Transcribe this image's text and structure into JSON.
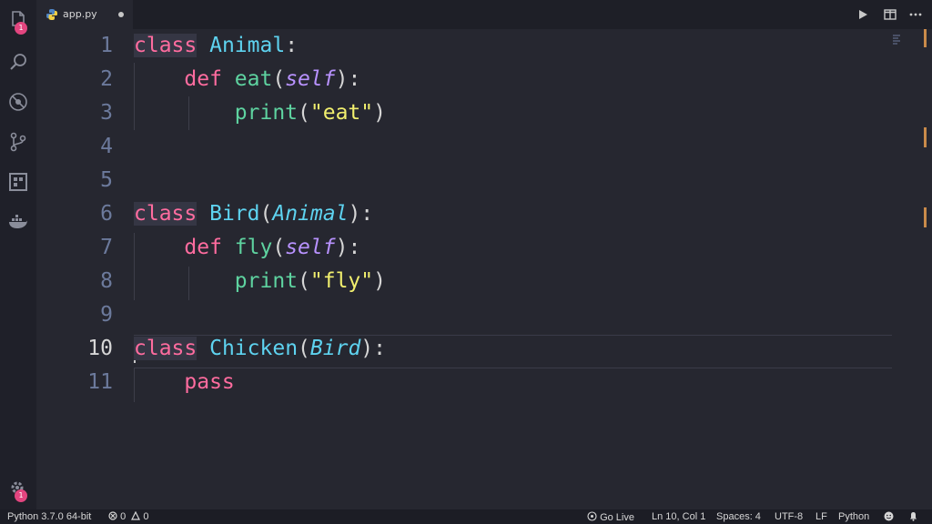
{
  "window": {
    "tab_title": "app.py"
  },
  "activity_bar": {
    "explorer_badge": "1",
    "settings_badge": "1"
  },
  "editor": {
    "line_numbers": [
      "1",
      "2",
      "3",
      "4",
      "5",
      "6",
      "7",
      "8",
      "9",
      "10",
      "11"
    ],
    "active_line": "10",
    "lines": [
      [
        [
          "k",
          "class"
        ],
        [
          "p",
          " "
        ],
        [
          "c",
          "Animal"
        ],
        [
          "p",
          ":"
        ]
      ],
      [
        [
          "p",
          "    "
        ],
        [
          "k",
          "def"
        ],
        [
          "p",
          " "
        ],
        [
          "f",
          "eat"
        ],
        [
          "p",
          "("
        ],
        [
          "self",
          "self"
        ],
        [
          "p",
          "):"
        ]
      ],
      [
        [
          "p",
          "        "
        ],
        [
          "f",
          "print"
        ],
        [
          "p",
          "("
        ],
        [
          "s",
          "\"eat\""
        ],
        [
          "p",
          ")"
        ]
      ],
      [],
      [],
      [
        [
          "k",
          "class"
        ],
        [
          "p",
          " "
        ],
        [
          "c",
          "Bird"
        ],
        [
          "p",
          "("
        ],
        [
          "inh",
          "Animal"
        ],
        [
          "p",
          "):"
        ]
      ],
      [
        [
          "p",
          "    "
        ],
        [
          "k",
          "def"
        ],
        [
          "p",
          " "
        ],
        [
          "f",
          "fly"
        ],
        [
          "p",
          "("
        ],
        [
          "self",
          "self"
        ],
        [
          "p",
          "):"
        ]
      ],
      [
        [
          "p",
          "        "
        ],
        [
          "f",
          "print"
        ],
        [
          "p",
          "("
        ],
        [
          "s",
          "\"fly\""
        ],
        [
          "p",
          ")"
        ]
      ],
      [],
      [
        [
          "k",
          "class"
        ],
        [
          "p",
          " "
        ],
        [
          "c",
          "Chicken"
        ],
        [
          "p",
          "("
        ],
        [
          "inh",
          "Bird"
        ],
        [
          "p",
          "):"
        ]
      ],
      [
        [
          "p",
          "    "
        ],
        [
          "k",
          "pass"
        ]
      ]
    ]
  },
  "status_bar": {
    "interpreter": "Python 3.7.0 64-bit",
    "errors": "0",
    "warnings": "0",
    "go_live": "Go Live",
    "cursor_position": "Ln 10, Col 1",
    "spaces": "Spaces: 4",
    "encoding": "UTF-8",
    "eol": "LF",
    "language": "Python"
  },
  "colors": {
    "keyword": "#ff6c9f",
    "class_name": "#5ed3f0",
    "function": "#5ed3a0",
    "string": "#f1ef6e",
    "self": "#b892ff",
    "background": "#262730"
  },
  "icons": [
    "files-icon",
    "search-icon",
    "debug-icon",
    "source-control-icon",
    "extensions-icon",
    "docker-icon",
    "settings-gear-icon",
    "python-file-icon",
    "run-icon",
    "split-editor-icon",
    "more-actions-icon",
    "error-icon",
    "warning-icon",
    "go-live-icon",
    "feedback-icon",
    "notifications-bell-icon"
  ]
}
